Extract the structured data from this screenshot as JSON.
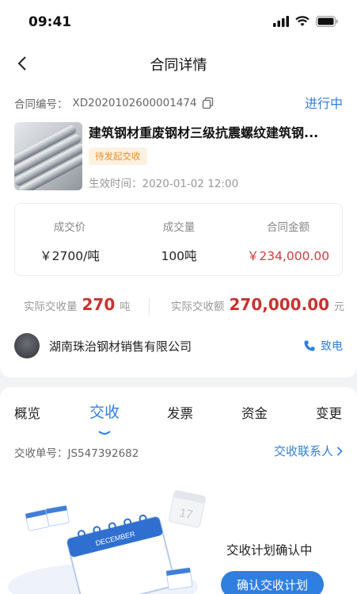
{
  "status_bar": {
    "time": "09:41"
  },
  "nav": {
    "title": "合同详情"
  },
  "contract": {
    "number_label": "合同编号：",
    "number": "XD2020102600001474",
    "status": "进行中",
    "product_title": "建筑钢材重废钢材三级抗震螺纹建筑钢...",
    "badge": "待发起交收",
    "effective_label": "生效时间：",
    "effective_time": "2020-01-02 12:00"
  },
  "summary": {
    "price_label": "成交价",
    "price_value": "￥2700/吨",
    "qty_label": "成交量",
    "qty_value": "100吨",
    "amount_label": "合同金额",
    "amount_value": "￥234,000.00"
  },
  "actual": {
    "qty_label": "实际交收量",
    "qty_value": "270",
    "qty_unit": "吨",
    "amount_label": "实际交收额",
    "amount_value": "270,000.00",
    "amount_unit": "元"
  },
  "company": {
    "name": "湖南珠治钢材销售有限公司",
    "call_label": "致电"
  },
  "tabs": [
    {
      "label": "概览"
    },
    {
      "label": "交收"
    },
    {
      "label": "发票"
    },
    {
      "label": "资金"
    },
    {
      "label": "变更"
    }
  ],
  "delivery": {
    "number_label": "交收单号：",
    "number": "JS547392682",
    "contacts_label": "交收联系人",
    "plan_status": "交收计划确认中",
    "confirm_label": "确认交收计划",
    "calendar_month": "DECEMBER",
    "calendar_day": "17"
  },
  "colors": {
    "primary": "#2f7fe0",
    "red": "#c8332f",
    "badge_text": "#e8902a",
    "badge_bg": "#fdf1e0"
  }
}
